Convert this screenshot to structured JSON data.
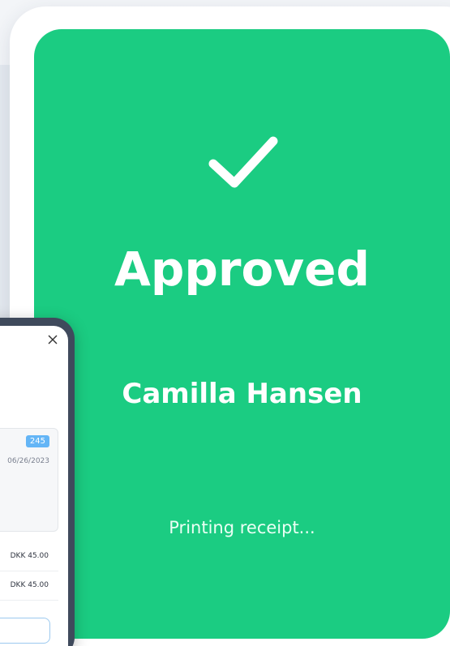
{
  "payment_status": {
    "title": "Approved",
    "customer_name": "Camilla Hansen",
    "message": "Printing receipt...",
    "icon": "checkmark-icon",
    "background_color": "#1bcc82",
    "text_color": "#ffffff"
  },
  "order_popup": {
    "order_badge": "245",
    "order_date": "06/26/2023",
    "line_items": [
      {
        "amount": "DKK 45.00"
      },
      {
        "amount": "DKK 45.00"
      }
    ],
    "badge_color": "#64b5f6",
    "frame_color": "#3f4a5c"
  }
}
